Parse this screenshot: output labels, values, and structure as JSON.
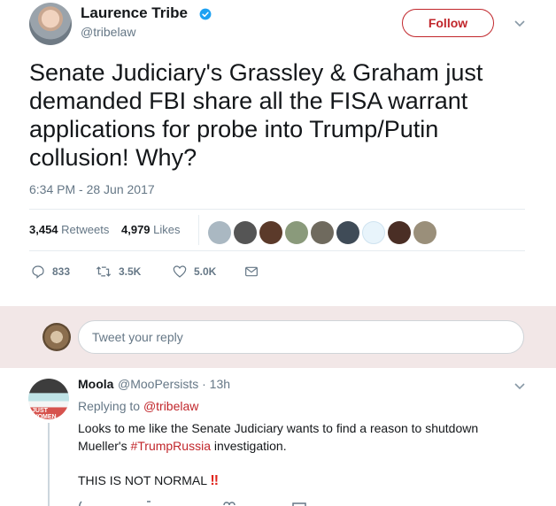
{
  "tweet": {
    "author": {
      "name": "Laurence Tribe",
      "handle": "@tribelaw",
      "verified": true
    },
    "follow_label": "Follow",
    "text": "Senate Judiciary's Grassley & Graham just demanded FBI share all the FISA warrant applications for probe into Trump/Putin collusion! Why?",
    "timestamp": "6:34 PM - 28 Jun 2017",
    "retweets_count": "3,454",
    "retweets_label": "Retweets",
    "likes_count": "4,979",
    "likes_label": "Likes",
    "actions": {
      "replies": "833",
      "retweets": "3.5K",
      "likes": "5.0K"
    }
  },
  "reply_box": {
    "placeholder": "Tweet your reply"
  },
  "reply": {
    "name": "Moola",
    "handle_time": "@MooPersists · 13h",
    "replying_prefix": "Replying to",
    "replying_to": "@tribelaw",
    "text_part1": "Looks to me like the Senate Judiciary wants to find a reason to shutdown Mueller's ",
    "hashtag": "#TrumpRussia",
    "text_part2": " investigation.",
    "text_line3": "THIS IS NOT NORMAL",
    "emoji": "‼",
    "avatar_text": "JUST WOMEN"
  },
  "colors": {
    "accent": "#c1262b",
    "secondary_text": "#657786",
    "reply_band": "#f2e7e7",
    "verified": "#1da1f2"
  }
}
